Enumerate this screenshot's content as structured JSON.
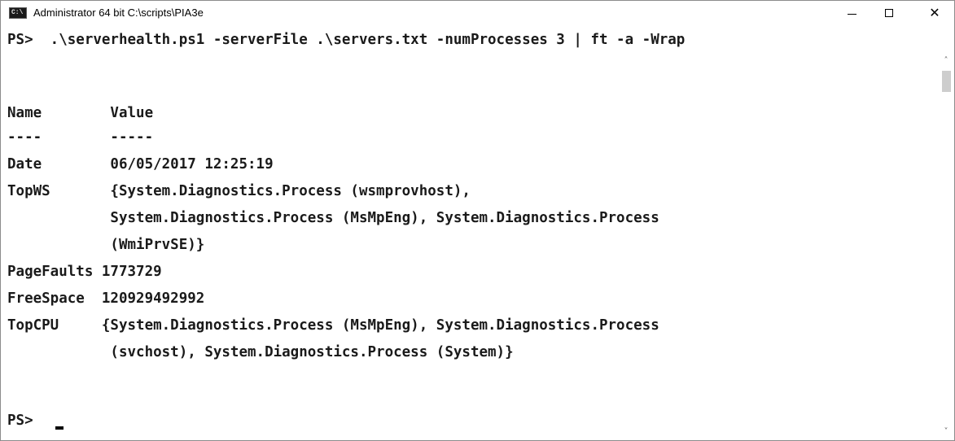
{
  "window": {
    "title": "Administrator 64 bit C:\\scripts\\PIA3e",
    "icon": "console-app-icon",
    "icon_glyph": "C:\\",
    "minimize_glyph": "minimize-icon",
    "maximize_glyph": "maximize-icon",
    "close_glyph": "✕"
  },
  "console": {
    "lines": [
      "PS>  .\\serverhealth.ps1 -serverFile .\\servers.txt -numProcesses 3 | ft -a -Wrap",
      "",
      "Name        Value",
      "----        -----",
      "Date        06/05/2017 12:25:19",
      "TopWS       {System.Diagnostics.Process (wsmprovhost),",
      "            System.Diagnostics.Process (MsMpEng), System.Diagnostics.Process",
      "            (WmiPrvSE)}",
      "PageFaults 1773729",
      "FreeSpace  120929492992",
      "TopCPU     {System.Diagnostics.Process (MsMpEng), System.Diagnostics.Process",
      "            (svchost), System.Diagnostics.Process (System)}",
      "",
      "",
      "",
      "PS>"
    ]
  },
  "scrollbar": {
    "up_arrow": "˄",
    "down_arrow": "˅"
  },
  "colors": {
    "background": "#ffffff",
    "text": "#1a1a1a",
    "scroll_thumb": "#cdcdcd"
  }
}
